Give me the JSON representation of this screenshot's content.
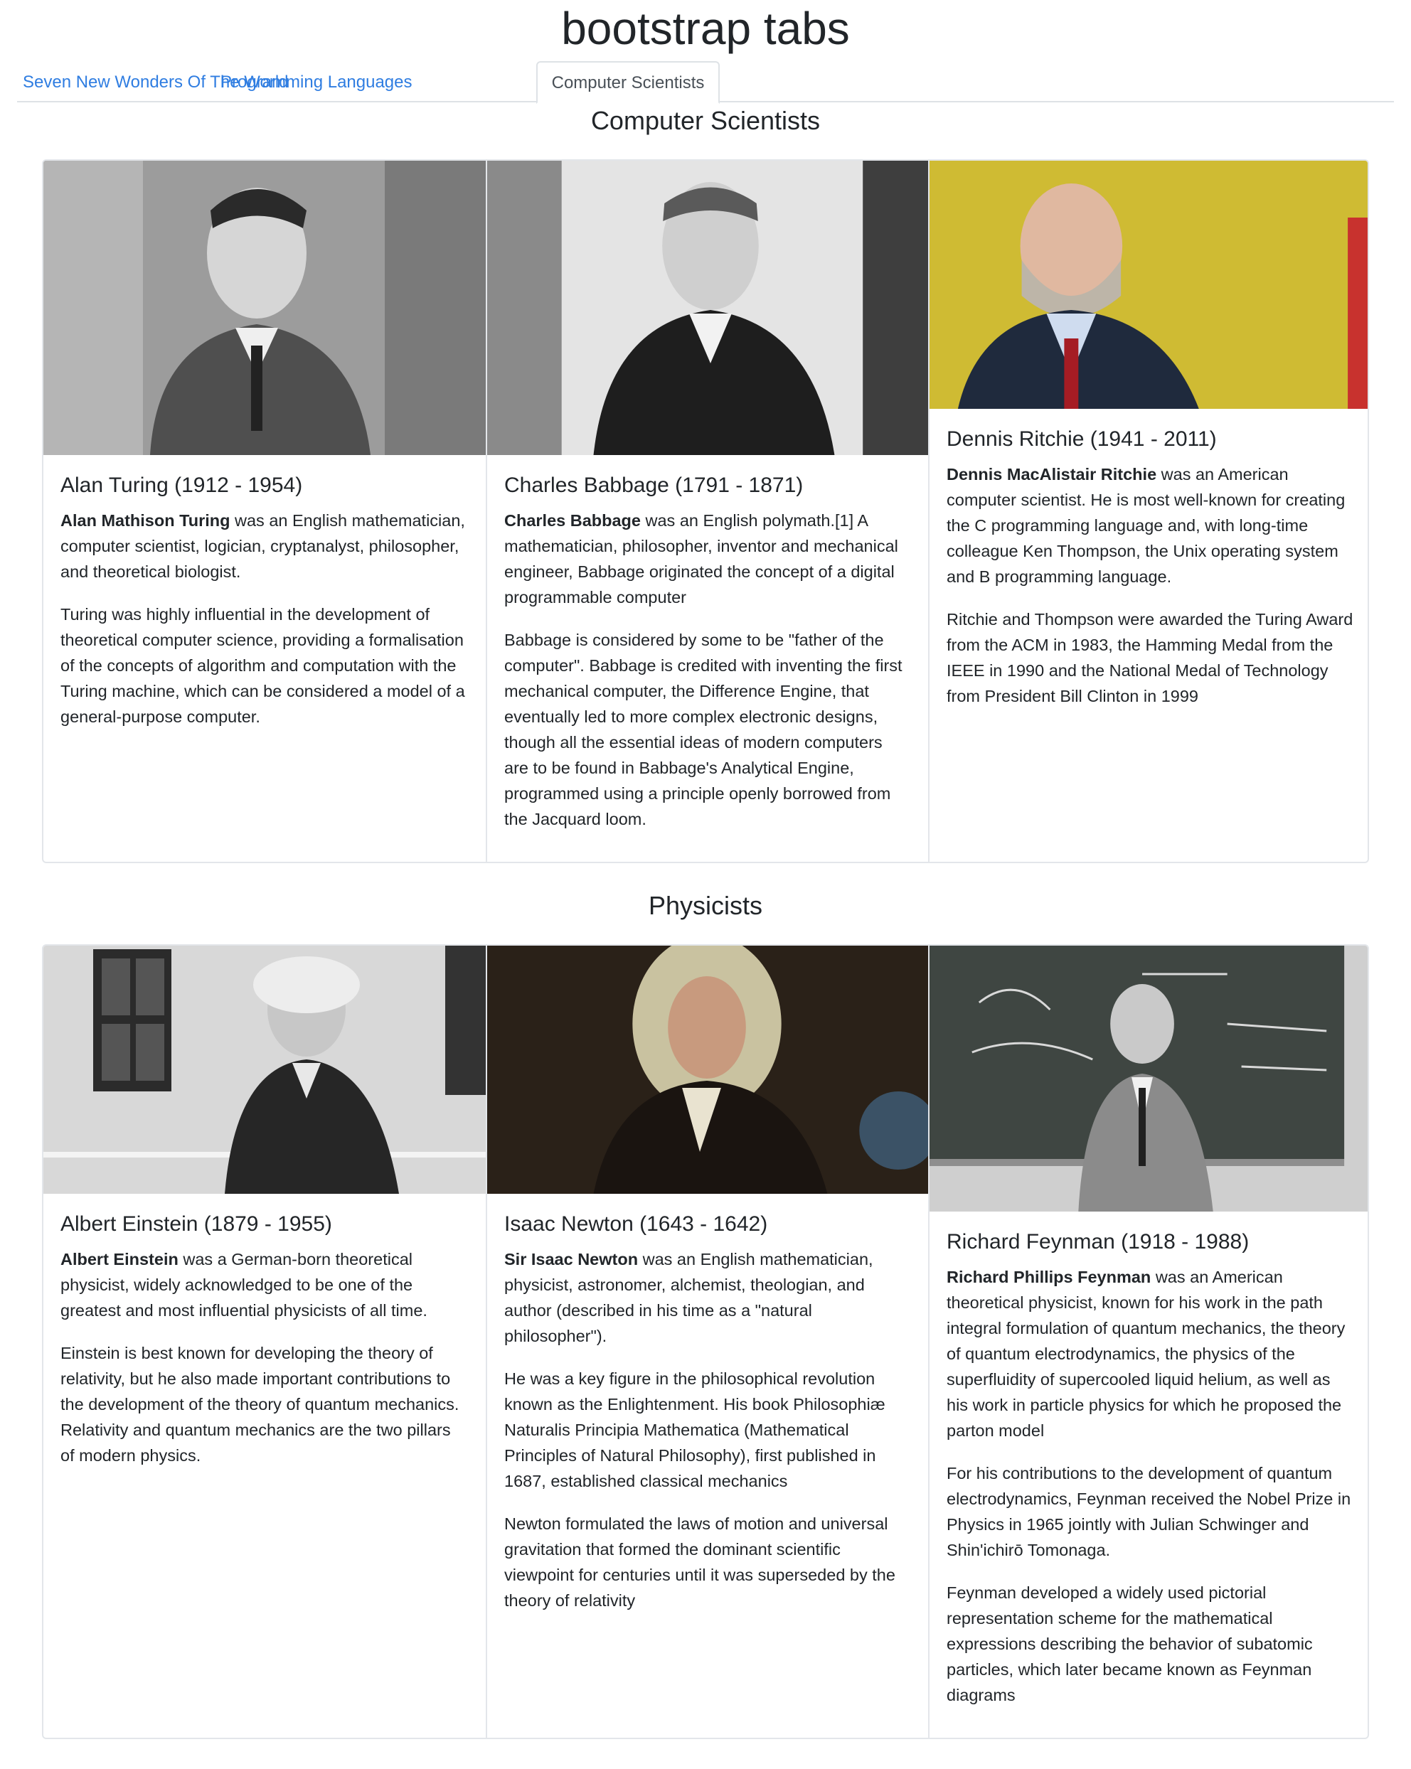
{
  "page": {
    "title": "bootstrap tabs"
  },
  "tabs": [
    {
      "label": "Seven New Wonders Of The World"
    },
    {
      "label": "Programming Languages"
    },
    {
      "label": "Computer Scientists"
    }
  ],
  "sections": {
    "computer_scientists": {
      "title": "Computer Scientists",
      "cards": [
        {
          "title": "Alan Turing (1912 - 1954)",
          "lead_name": "Alan Mathison Turing",
          "lead_rest": " was an English mathematician, computer scientist, logician, cryptanalyst, philosopher, and theoretical biologist.",
          "paragraphs": [
            "Turing was highly influential in the development of theoretical computer science, providing a formalisation of the concepts of algorithm and computation with the Turing machine, which can be considered a model of a general-purpose computer."
          ]
        },
        {
          "title": "Charles Babbage (1791 - 1871)",
          "lead_name": "Charles Babbage",
          "lead_rest": " was an English polymath.[1] A mathematician, philosopher, inventor and mechanical engineer, Babbage originated the concept of a digital programmable computer",
          "paragraphs": [
            "Babbage is considered by some to be \"father of the computer\". Babbage is credited with inventing the first mechanical computer, the Difference Engine, that eventually led to more complex electronic designs, though all the essential ideas of modern computers are to be found in Babbage's Analytical Engine, programmed using a principle openly borrowed from the Jacquard loom."
          ]
        },
        {
          "title": "Dennis Ritchie (1941 - 2011)",
          "lead_name": "Dennis MacAlistair Ritchie",
          "lead_rest": " was an American computer scientist. He is most well-known for creating the C programming language and, with long-time colleague Ken Thompson, the Unix operating system and B programming language.",
          "paragraphs": [
            "Ritchie and Thompson were awarded the Turing Award from the ACM in 1983, the Hamming Medal from the IEEE in 1990 and the National Medal of Technology from President Bill Clinton in 1999"
          ]
        }
      ]
    },
    "physicists": {
      "title": "Physicists",
      "cards": [
        {
          "title": "Albert Einstein (1879 - 1955)",
          "lead_name": "Albert Einstein",
          "lead_rest": " was a German-born theoretical physicist, widely acknowledged to be one of the greatest and most influential physicists of all time.",
          "paragraphs": [
            "Einstein is best known for developing the theory of relativity, but he also made important contributions to the development of the theory of quantum mechanics. Relativity and quantum mechanics are the two pillars of modern physics."
          ]
        },
        {
          "title": "Isaac Newton (1643 - 1642)",
          "lead_name": "Sir Isaac Newton",
          "lead_rest": " was an English mathematician, physicist, astronomer, alchemist, theologian, and author (described in his time as a \"natural philosopher\").",
          "paragraphs": [
            "He was a key figure in the philosophical revolution known as the Enlightenment. His book Philosophiæ Naturalis Principia Mathematica (Mathematical Principles of Natural Philosophy), first published in 1687, established classical mechanics",
            "Newton formulated the laws of motion and universal gravitation that formed the dominant scientific viewpoint for centuries until it was superseded by the theory of relativity"
          ]
        },
        {
          "title": "Richard Feynman (1918 - 1988)",
          "lead_name": "Richard Phillips Feynman",
          "lead_rest": " was an American theoretical physicist, known for his work in the path integral formulation of quantum mechanics, the theory of quantum electrodynamics, the physics of the superfluidity of supercooled liquid helium, as well as his work in particle physics for which he proposed the parton model",
          "paragraphs": [
            "For his contributions to the development of quantum electrodynamics, Feynman received the Nobel Prize in Physics in 1965 jointly with Julian Schwinger and Shin'ichirō Tomonaga.",
            "Feynman developed a widely used pictorial representation scheme for the mathematical expressions describing the behavior of subatomic particles, which later became known as Feynman diagrams"
          ]
        }
      ]
    }
  },
  "colors": {
    "link": "#2f7de1",
    "active_tab_text": "#495057",
    "border": "#dee2e6",
    "text": "#212529"
  }
}
